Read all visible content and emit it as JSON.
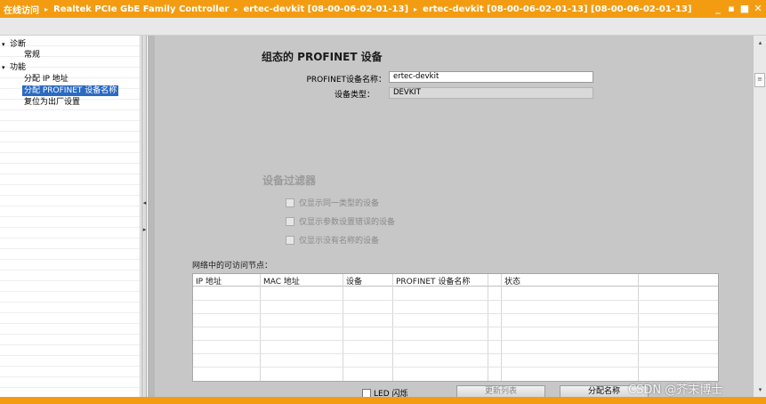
{
  "title_bar": {
    "segments": [
      "在线访问",
      "Realtek PCIe GbE Family Controller",
      "ertec-devkit [08-00-06-02-01-13]",
      "ertec-devkit [08-00-06-02-01-13] [08-00-06-02-01-13]"
    ],
    "separator": "▸",
    "buttons": [
      "_",
      "▪",
      "■",
      "✕"
    ]
  },
  "tree": {
    "items": [
      {
        "label": "诊断",
        "caret": "▾"
      },
      {
        "label": "常规",
        "caret": ""
      },
      {
        "label": "功能",
        "caret": "▾"
      },
      {
        "label": "分配 IP 地址",
        "caret": ""
      },
      {
        "label": "分配 PROFINET 设备名称",
        "caret": "",
        "selected": true
      },
      {
        "label": "复位为出厂设置",
        "caret": ""
      }
    ]
  },
  "splitter": {
    "up_arrow": "◂",
    "down_arrow": "▸"
  },
  "config": {
    "title": "组态的 PROFINET 设备",
    "name_label": "PROFINET设备名称：",
    "name_value": "ertec-devkit",
    "type_label": "设备类型：",
    "type_value": "DEVKIT"
  },
  "filter": {
    "title": "设备过滤器",
    "options": [
      "仅显示同一类型的设备",
      "仅显示参数设置错误的设备",
      "仅显示没有名称的设备"
    ]
  },
  "network": {
    "label": "网络中的可访问节点：",
    "columns": [
      "IP 地址",
      "MAC 地址",
      "设备",
      "PROFINET 设备名称",
      "状态"
    ]
  },
  "bottom": {
    "led_label": "LED 闪烁",
    "refresh_label": "更新列表",
    "assign_label": "分配名称"
  },
  "scrollbar": {
    "up": "▴",
    "down": "▾",
    "thumb": "≡"
  },
  "watermark": "CSDN @芥末博士",
  "colors": {
    "accent": "#f39c12",
    "selection": "#2b6ac2",
    "panel": "#c7c7c7"
  }
}
